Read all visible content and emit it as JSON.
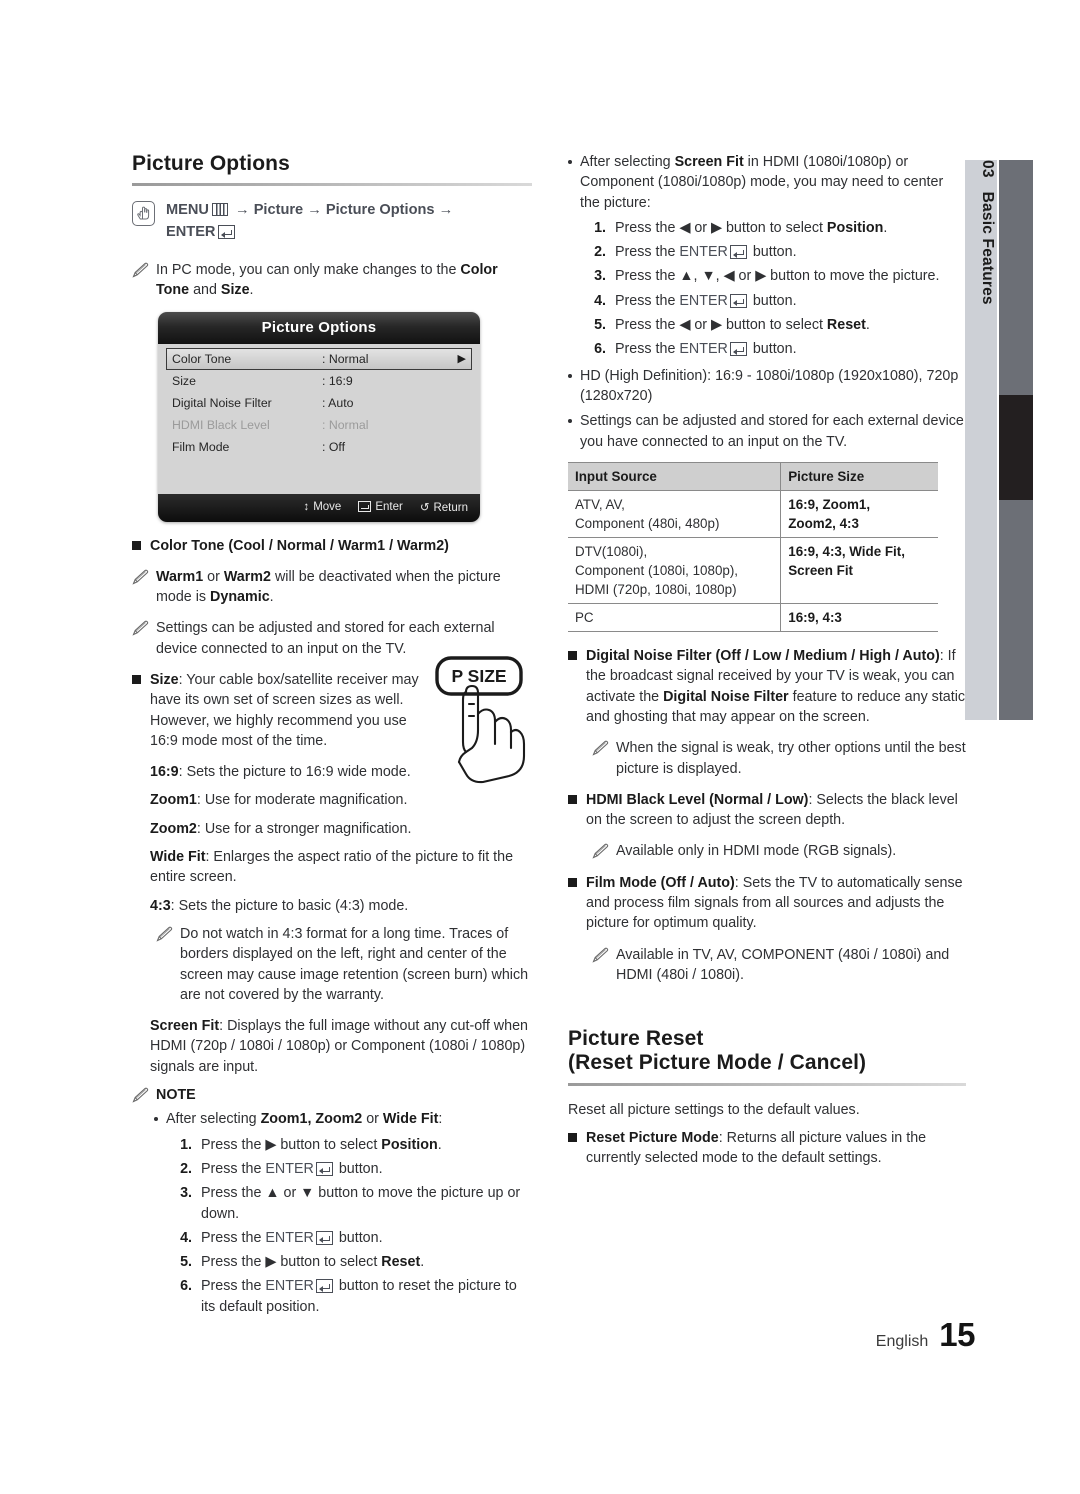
{
  "sidetab": {
    "number": "03",
    "label": "Basic Features"
  },
  "footer": {
    "language": "English",
    "page": "15"
  },
  "left": {
    "heading": "Picture Options",
    "navpath": {
      "menu": "MENU",
      "arrow1": "→ Picture → Picture Options →",
      "enter": "ENTER"
    },
    "pc_note_1": "In PC mode, you can only make changes to the ",
    "pc_note_bold1": "Color Tone",
    "pc_note_2": " and ",
    "pc_note_bold2": "Size",
    "pc_note_3": ".",
    "osd": {
      "title": "Picture Options",
      "rows": [
        {
          "key": "Color Tone",
          "value": ": Normal",
          "selected": true,
          "dim": false,
          "arrow": "▶"
        },
        {
          "key": "Size",
          "value": ": 16:9",
          "selected": false,
          "dim": false,
          "arrow": ""
        },
        {
          "key": "Digital Noise Filter",
          "value": ": Auto",
          "selected": false,
          "dim": false,
          "arrow": ""
        },
        {
          "key": "HDMI Black Level",
          "value": ": Normal",
          "selected": false,
          "dim": true,
          "arrow": ""
        },
        {
          "key": "Film Mode",
          "value": ": Off",
          "selected": false,
          "dim": false,
          "arrow": ""
        }
      ],
      "footer": {
        "move": "Move",
        "enter": "Enter",
        "return": "Return",
        "move_icon": "↕",
        "return_icon": "↺"
      }
    },
    "color_tone_item": "Color Tone (Cool / Normal / Warm1 / Warm2)",
    "warm_note": {
      "b1": "Warm1",
      "t1": " or ",
      "b2": "Warm2",
      "t2": " will be deactivated when the picture mode is ",
      "b3": "Dynamic",
      "t3": "."
    },
    "settings_note": "Settings can be adjusted and stored for each external device connected to an input on the TV.",
    "size_item": {
      "label": "Size",
      "text": ": Your cable box/satellite receiver may have its own set of screen sizes as well. However, we highly recommend you use 16:9 mode most of the time."
    },
    "remote_button": "P SIZE",
    "size_modes": [
      {
        "label": "16:9",
        "text": ": Sets the picture to 16:9 wide mode."
      },
      {
        "label": "Zoom1",
        "text": ": Use for moderate magnification."
      },
      {
        "label": "Zoom2",
        "text": ": Use for a stronger magnification."
      },
      {
        "label": "Wide Fit",
        "text": ": Enlarges the aspect ratio of the picture to fit the entire screen."
      },
      {
        "label": "4:3",
        "text": ": Sets the picture to basic (4:3) mode."
      }
    ],
    "ratio43_note": "Do not watch in 4:3 format for a long time. Traces of borders displayed on the left, right and center of the screen may cause image retention (screen burn) which are not covered by the warranty.",
    "screen_fit": {
      "label": "Screen Fit",
      "text": ": Displays the full image without any cut-off when HDMI (720p / 1080i / 1080p) or Component (1080i / 1080p) signals are input."
    },
    "note_title": "NOTE",
    "note_bullet": {
      "t1": "After selecting ",
      "b1": "Zoom1, Zoom2",
      "t2": " or ",
      "b2": "Wide Fit",
      "t3": ":"
    },
    "note_steps": [
      {
        "n": "1.",
        "pre": "Press the ▶ button to select ",
        "bold": "Position",
        "post": "."
      },
      {
        "n": "2.",
        "pre": "Press the ",
        "enter": true,
        "post": " button."
      },
      {
        "n": "3.",
        "pre": "Press the ▲ or ▼ button to move the picture up or down.",
        "bold": "",
        "post": ""
      },
      {
        "n": "4.",
        "pre": "Press the ",
        "enter": true,
        "post": " button."
      },
      {
        "n": "5.",
        "pre": "Press the ▶ button to select ",
        "bold": "Reset",
        "post": "."
      },
      {
        "n": "6.",
        "pre": "Press the ",
        "enter": true,
        "post": " button to reset the picture to its default position."
      }
    ]
  },
  "right": {
    "screenfit_bullet": {
      "t1": "After selecting ",
      "b1": "Screen Fit",
      "t2": " in HDMI (1080i/1080p) or Component (1080i/1080p) mode, you may need to center the picture:"
    },
    "screenfit_steps": [
      {
        "n": "1.",
        "pre": "Press the ◀ or ▶ button to select ",
        "bold": "Position",
        "post": "."
      },
      {
        "n": "2.",
        "pre": "Press the ",
        "enter": true,
        "post": " button."
      },
      {
        "n": "3.",
        "pre": "Press the ▲, ▼, ◀ or ▶ button to move the picture.",
        "bold": "",
        "post": ""
      },
      {
        "n": "4.",
        "pre": "Press the ",
        "enter": true,
        "post": " button."
      },
      {
        "n": "5.",
        "pre": "Press the ◀ or ▶ button to select ",
        "bold": "Reset",
        "post": "."
      },
      {
        "n": "6.",
        "pre": "Press the ",
        "enter": true,
        "post": " button."
      }
    ],
    "hd_bullet": "HD (High Definition): 16:9 - 1080i/1080p (1920x1080), 720p (1280x720)",
    "settings_bullet": "Settings can be adjusted and stored for each external device you have connected to an input on the TV.",
    "table": {
      "headers": [
        "Input Source",
        "Picture Size"
      ],
      "rows": [
        {
          "source": "ATV, AV,\nComponent (480i, 480p)",
          "size": "16:9, Zoom1,\nZoom2, 4:3"
        },
        {
          "source": "DTV(1080i),\nComponent (1080i, 1080p),\nHDMI (720p, 1080i, 1080p)",
          "size": "16:9, 4:3, Wide Fit,\nScreen Fit"
        },
        {
          "source": "PC",
          "size": "16:9, 4:3"
        }
      ]
    },
    "dnf_item": {
      "bold": "Digital Noise Filter (Off / Low / Medium / High / Auto)",
      "t1": ": If the broadcast signal received by your TV is weak, you can activate the ",
      "b2": "Digital Noise Filter",
      "t2": " feature to reduce any static and ghosting that may appear on the screen."
    },
    "dnf_note": "When the signal is weak, try other options until the best picture is displayed.",
    "hdmi_item": {
      "bold": "HDMI Black Level (Normal / Low)",
      "text": ": Selects the black level on the screen to adjust the screen depth."
    },
    "hdmi_note": "Available only in HDMI mode (RGB signals).",
    "film_item": {
      "bold": "Film Mode (Off / Auto)",
      "text": ": Sets the TV to automatically sense and process film signals from all sources and adjusts the picture for optimum quality."
    },
    "film_note": "Available in TV, AV, COMPONENT (480i / 1080i) and HDMI (480i / 1080i).",
    "reset_heading_1": "Picture Reset",
    "reset_heading_2": "(Reset Picture Mode / Cancel)",
    "reset_intro": "Reset all picture settings to the default values.",
    "reset_item": {
      "bold": "Reset Picture Mode",
      "text": ": Returns all picture values in the currently selected mode to the default settings."
    }
  }
}
